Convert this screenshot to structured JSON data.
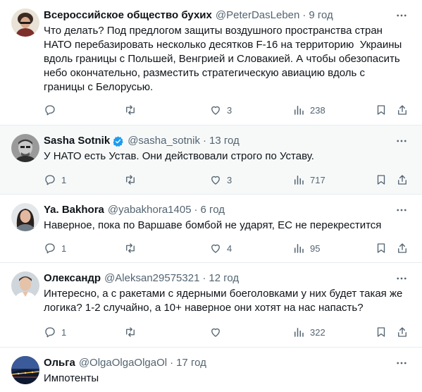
{
  "tweets": [
    {
      "name": "Всероссийское общество бухих",
      "handle": "@PeterDasLeben",
      "time": "9 год",
      "verified": false,
      "text": "Что делать? Под предлогом защиты воздушного пространства стран\nНАТО перебазировать несколько десятков F-16 на территорию  Украины\nвдоль границы с Польшей, Венгрией и Словакией. А чтобы обезопасить\nнебо окончательно, разместить стратегическую авиацию вдоль с\nграницы с Белорусью.",
      "replies": "",
      "retweets": "",
      "likes": "3",
      "views": "238"
    },
    {
      "name": "Sasha Sotnik",
      "handle": "@sasha_sotnik",
      "time": "13 год",
      "verified": true,
      "text": "У НАТО есть Устав. Они действовали строго по Уставу.",
      "replies": "1",
      "retweets": "",
      "likes": "3",
      "views": "717"
    },
    {
      "name": "Ya. Bakhora",
      "handle": "@yabakhora1405",
      "time": "6 год",
      "verified": false,
      "text": "Наверное, пока по Варшаве бомбой не ударят, ЕС не перекрестится",
      "replies": "1",
      "retweets": "",
      "likes": "4",
      "views": "95"
    },
    {
      "name": "Олександр",
      "handle": "@Aleksan29575321",
      "time": "12 год",
      "verified": false,
      "text": "Интересно, а с ракетами с ядерными боеголовками у них будет такая же\nлогика? 1-2 случайно, а 10+ наверное они хотят на нас напасть?",
      "replies": "1",
      "retweets": "",
      "likes": "",
      "views": "322"
    },
    {
      "name": "Ольга",
      "handle": "@OlgaOlgaOlgaOl",
      "time": "17 год",
      "verified": false,
      "text": "Импотенты"
    }
  ],
  "icons": {
    "more": "more-horizontal-icon",
    "reply": "reply-icon",
    "retweet": "retweet-icon",
    "like": "heart-icon",
    "views": "views-icon",
    "bookmark": "bookmark-icon",
    "share": "share-icon",
    "verified": "verified-badge-icon"
  },
  "colors": {
    "text": "#0f1419",
    "secondary": "#536471",
    "verified": "#1d9bf0",
    "divider": "#e6ecf0",
    "highlight_bg": "#f7f9f9"
  }
}
